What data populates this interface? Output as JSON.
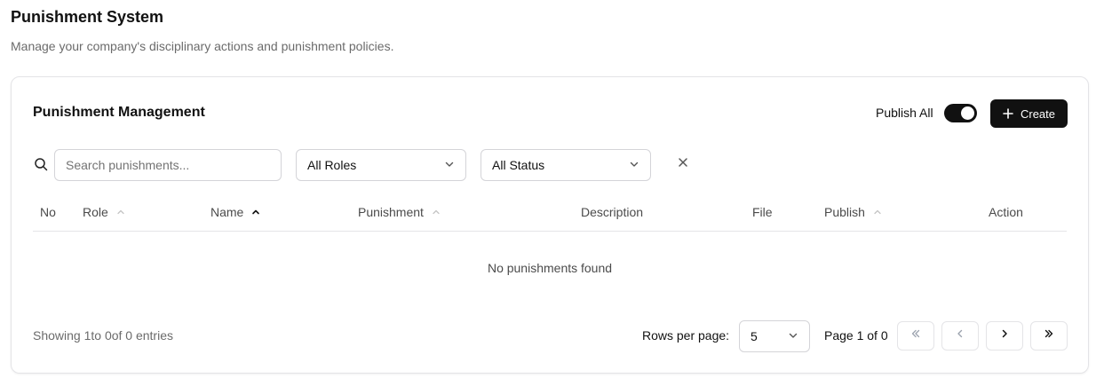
{
  "page": {
    "title": "Punishment System",
    "subtitle": "Manage your company's disciplinary actions and punishment policies."
  },
  "card": {
    "title": "Punishment Management",
    "publish_all_label": "Publish All",
    "publish_all_on": true,
    "create_label": "Create"
  },
  "filters": {
    "search_placeholder": "Search punishments...",
    "search_value": "",
    "role_selected": "All Roles",
    "status_selected": "All Status"
  },
  "table": {
    "columns": {
      "no": "No",
      "role": "Role",
      "name": "Name",
      "punishment": "Punishment",
      "description": "Description",
      "file": "File",
      "publish": "Publish",
      "action": "Action"
    },
    "rows": [],
    "empty_text": "No punishments found"
  },
  "footer": {
    "showing_text": "Showing 1to 0of 0 entries",
    "rows_per_page_label": "Rows per page:",
    "rows_per_page_value": "5",
    "page_info": "Page 1 of 0"
  },
  "colors": {
    "primary": "#111111",
    "border": "#e4e4e7",
    "muted_text": "#6b6b6b"
  }
}
